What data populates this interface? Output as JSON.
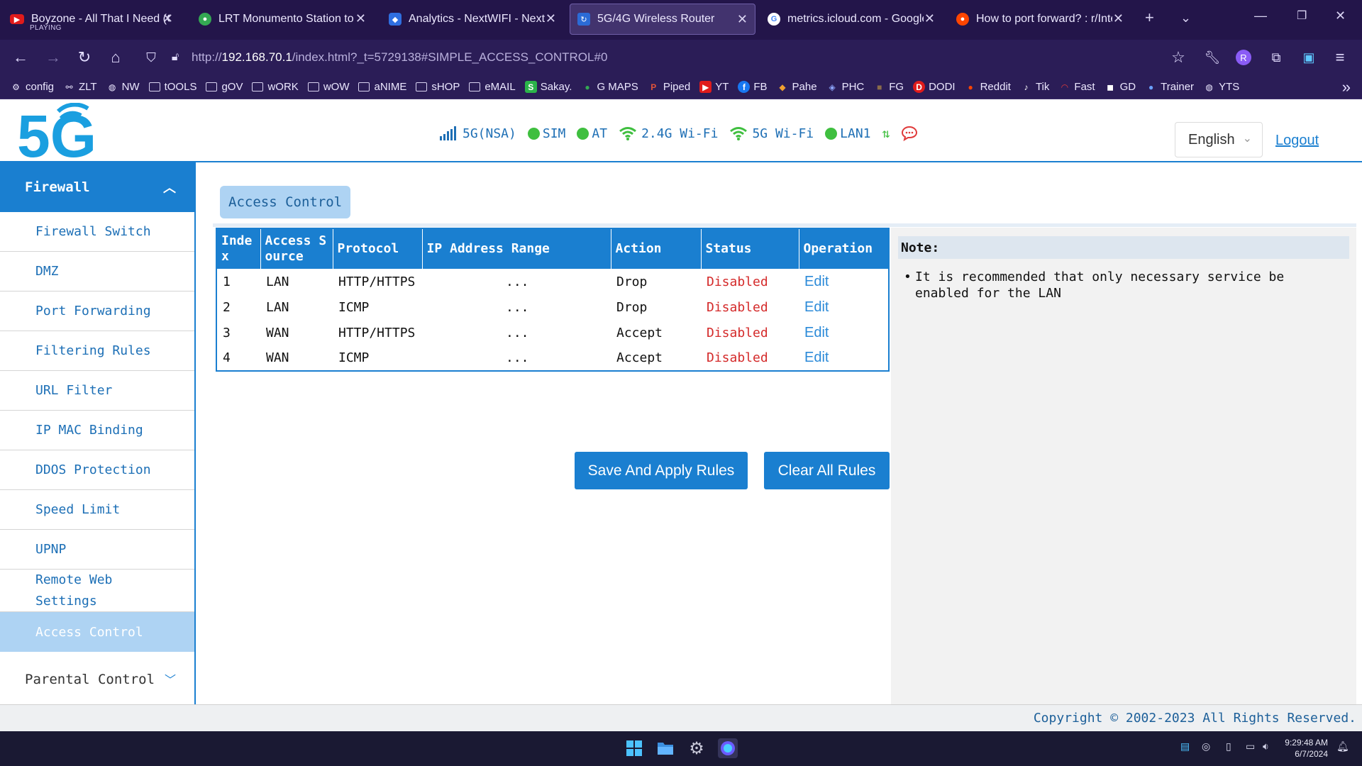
{
  "browser": {
    "tabs": [
      {
        "title": "Boyzone - All That I Need (Of",
        "playing": "PLAYING",
        "icon": "youtube-icon"
      },
      {
        "title": "LRT Monumento Station to Jo",
        "icon": "maps-pin-icon"
      },
      {
        "title": "Analytics - NextWIFI - NextD",
        "icon": "shield-icon"
      },
      {
        "title": "5G/4G Wireless Router",
        "icon": "router-icon"
      },
      {
        "title": "metrics.icloud.com - Google",
        "icon": "google-icon"
      },
      {
        "title": "How to port forward? : r/Inte",
        "icon": "reddit-icon"
      }
    ],
    "url_prefix": "http://",
    "url_host": "192.168.70.1",
    "url_rest": "/index.html?_t=5729138#SIMPLE_ACCESS_CONTROL#0",
    "bookmarks": [
      {
        "label": "config",
        "icon": "gear-icon"
      },
      {
        "label": "ZLT",
        "icon": "link-icon"
      },
      {
        "label": "NW",
        "icon": "globe-icon"
      },
      {
        "label": "tOOLS",
        "icon": "folder-icon"
      },
      {
        "label": "gOV",
        "icon": "folder-icon"
      },
      {
        "label": "wORK",
        "icon": "folder-icon"
      },
      {
        "label": "wOW",
        "icon": "folder-icon"
      },
      {
        "label": "aNIME",
        "icon": "folder-icon"
      },
      {
        "label": "sHOP",
        "icon": "folder-icon"
      },
      {
        "label": "eMAIL",
        "icon": "folder-icon"
      },
      {
        "label": "Sakay.",
        "icon": "sakay-icon"
      },
      {
        "label": "G MAPS",
        "icon": "maps-pin-icon"
      },
      {
        "label": "Piped",
        "icon": "piped-icon"
      },
      {
        "label": "YT",
        "icon": "youtube-icon"
      },
      {
        "label": "FB",
        "icon": "facebook-icon"
      },
      {
        "label": "Pahe",
        "icon": "pahe-icon"
      },
      {
        "label": "PHC",
        "icon": "phc-icon"
      },
      {
        "label": "FG",
        "icon": "fg-icon"
      },
      {
        "label": "DODI",
        "icon": "dodi-icon"
      },
      {
        "label": "Reddit",
        "icon": "reddit-icon"
      },
      {
        "label": "Tik",
        "icon": "tiktok-icon"
      },
      {
        "label": "Fast",
        "icon": "speedometer-icon"
      },
      {
        "label": "GD",
        "icon": "gamepad-icon"
      },
      {
        "label": "Trainer",
        "icon": "trainer-icon"
      },
      {
        "label": "YTS",
        "icon": "globe-icon"
      }
    ]
  },
  "header": {
    "network": "5G(NSA)",
    "sim": "SIM",
    "at": "AT",
    "wifi24": "2.4G Wi-Fi",
    "wifi5": "5G Wi-Fi",
    "lan": "LAN1",
    "language": "English",
    "logout": "Logout"
  },
  "sidebar": {
    "section": "Firewall",
    "items": [
      "Firewall Switch",
      "DMZ",
      "Port Forwarding",
      "Filtering Rules",
      "URL Filter",
      "IP MAC Binding",
      "DDOS Protection",
      "Speed Limit",
      "UPNP"
    ],
    "remote_line1": "Remote Web",
    "remote_line2": "Settings",
    "active": "Access Control",
    "next_section": "Parental Control"
  },
  "main": {
    "title": "Access Control",
    "columns": [
      "Inde x",
      "Access S ource",
      "Protocol",
      "IP Address Range",
      "Action",
      "Status",
      "Operation"
    ],
    "rows": [
      {
        "index": "1",
        "source": "LAN",
        "protocol": "HTTP/HTTPS",
        "range": "...",
        "action": "Drop",
        "status": "Disabled",
        "op": "Edit"
      },
      {
        "index": "2",
        "source": "LAN",
        "protocol": "ICMP",
        "range": "...",
        "action": "Drop",
        "status": "Disabled",
        "op": "Edit"
      },
      {
        "index": "3",
        "source": "WAN",
        "protocol": "HTTP/HTTPS",
        "range": "...",
        "action": "Accept",
        "status": "Disabled",
        "op": "Edit"
      },
      {
        "index": "4",
        "source": "WAN",
        "protocol": "ICMP",
        "range": "...",
        "action": "Accept",
        "status": "Disabled",
        "op": "Edit"
      }
    ],
    "save_button": "Save And Apply Rules",
    "clear_button": "Clear All Rules",
    "note_title": "Note:",
    "note_text": "It is recommended that only necessary service be enabled for the LAN"
  },
  "footer": {
    "copyright": "Copyright © 2002-2023 All Rights Reserved."
  },
  "taskbar": {
    "time": "9:29:48 AM",
    "date": "6/7/2024"
  },
  "colors": {
    "brand": "#1a7fd0",
    "active_item": "#aed3f3",
    "disabled": "#d42a2a",
    "browser_bg": "#2b1d57"
  }
}
